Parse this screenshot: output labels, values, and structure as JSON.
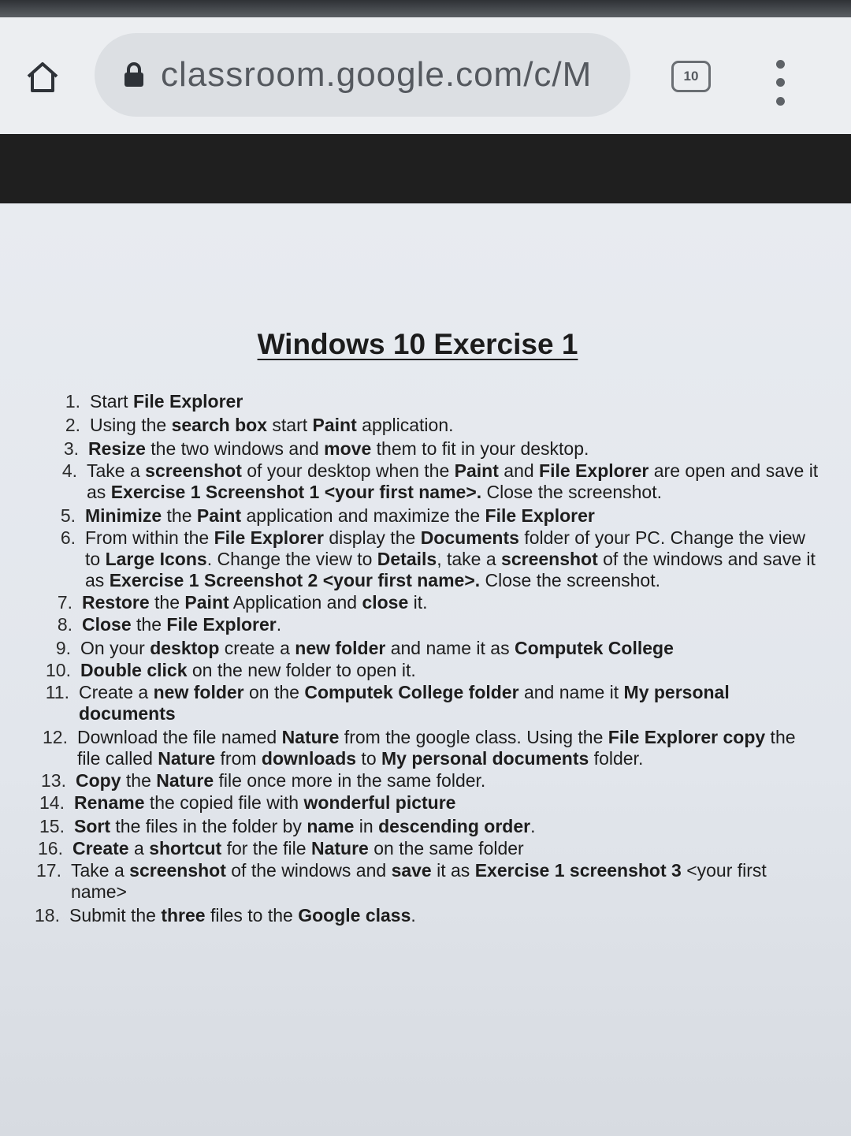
{
  "browser": {
    "url": "classroom.google.com/c/M",
    "tab_count": "10"
  },
  "document": {
    "title": "Windows 10 Exercise 1",
    "steps": [
      {
        "n": "1.",
        "html": "Start <b>File Explorer</b>"
      },
      {
        "n": "2.",
        "html": "Using the <b>search box</b> start <b>Paint</b> application."
      },
      {
        "n": "3.",
        "html": "<b>Resize</b> the two windows and <b>move</b> them to fit in your desktop."
      },
      {
        "n": "4.",
        "html": "Take a <b>screenshot</b> of your desktop when the <b>Paint</b> and <b>File Explorer</b> are open and save it as <b>Exercise 1 Screenshot 1 &lt;your first name&gt;.</b> Close the screenshot."
      },
      {
        "n": "5.",
        "html": "<b>Minimize</b> the <b>Paint</b> application and maximize the <b>File Explorer</b>"
      },
      {
        "n": "6.",
        "html": "From within the <b>File Explorer</b> display the <b>Documents</b> folder of your PC. Change the view to <b>Large Icons</b>. Change the view to <b>Details</b>, take a <b>screenshot</b> of the windows and save it as <b>Exercise 1 Screenshot 2 &lt;your first name&gt;.</b> Close the screenshot."
      },
      {
        "n": "7.",
        "html": "<b>Restore</b> the <b>Paint</b> Application and <b>close</b> it."
      },
      {
        "n": "8.",
        "html": "<b>Close</b> the <b>File Explorer</b>."
      },
      {
        "n": "9.",
        "html": "On your <b>desktop</b> create a <b>new folder</b> and name it as <b>Computek College</b>"
      },
      {
        "n": "10.",
        "html": "<b>Double click</b> on the new folder to open it."
      },
      {
        "n": "11.",
        "html": "Create a <b>new folder</b> on the <b>Computek College folder</b> and name it <b>My personal documents</b>"
      },
      {
        "n": "12.",
        "html": "Download the file named <b>Nature</b> from the google class. Using the <b>File Explorer copy</b> the file called <b>Nature</b> from <b>downloads</b> to <b>My personal documents</b> folder."
      },
      {
        "n": "13.",
        "html": "<b>Copy</b> the <b>Nature</b> file once more in the same folder."
      },
      {
        "n": "14.",
        "html": "<b>Rename</b> the copied file with <b>wonderful picture</b>"
      },
      {
        "n": "15.",
        "html": "<b>Sort</b> the files in the folder by <b>name</b> in <b>descending order</b>."
      },
      {
        "n": "16.",
        "html": "<b>Create</b> a <b>shortcut</b> for the file <b>Nature</b> on the same folder"
      },
      {
        "n": "17.",
        "html": "Take a <b>screenshot</b> of the windows and <b>save</b> it as <b>Exercise 1 screenshot 3</b> &lt;your first name&gt;"
      },
      {
        "n": "18.",
        "html": "Submit the <b>three</b> files to the <b>Google class</b>."
      }
    ]
  }
}
